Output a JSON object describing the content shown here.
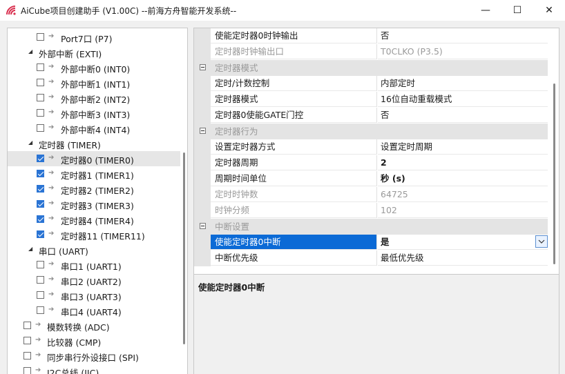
{
  "window": {
    "title": "AiCube项目创建助手 (V1.00C) --前海方舟智能开发系统--",
    "minimize": "—",
    "maximize": "☐",
    "close": "✕"
  },
  "tree": {
    "items": [
      {
        "label": "Port7口 (P7)",
        "checked": false
      },
      {
        "label": "外部中断 (EXTI)"
      },
      {
        "label": "外部中断0 (INT0)",
        "checked": false
      },
      {
        "label": "外部中断1 (INT1)",
        "checked": false
      },
      {
        "label": "外部中断2 (INT2)",
        "checked": false
      },
      {
        "label": "外部中断3 (INT3)",
        "checked": false
      },
      {
        "label": "外部中断4 (INT4)",
        "checked": false
      },
      {
        "label": "定时器 (TIMER)"
      },
      {
        "label": "定时器0 (TIMER0)",
        "checked": true,
        "selected": true
      },
      {
        "label": "定时器1 (TIMER1)",
        "checked": true
      },
      {
        "label": "定时器2 (TIMER2)",
        "checked": true
      },
      {
        "label": "定时器3 (TIMER3)",
        "checked": true
      },
      {
        "label": "定时器4 (TIMER4)",
        "checked": true
      },
      {
        "label": "定时器11 (TIMER11)",
        "checked": true
      },
      {
        "label": "串口 (UART)"
      },
      {
        "label": "串口1 (UART1)",
        "checked": false
      },
      {
        "label": "串口2 (UART2)",
        "checked": false
      },
      {
        "label": "串口3 (UART3)",
        "checked": false
      },
      {
        "label": "串口4 (UART4)",
        "checked": false
      },
      {
        "label": "模数转换 (ADC)",
        "checked": false
      },
      {
        "label": "比较器 (CMP)",
        "checked": false
      },
      {
        "label": "同步串行外设接口 (SPI)",
        "checked": false
      },
      {
        "label": "I2C总线 (IIC)",
        "checked": false
      }
    ]
  },
  "grid": {
    "rows": [
      {
        "name": "使能定时器0时钟输出",
        "value": "否"
      },
      {
        "name": "定时器时钟输出口",
        "value": "T0CLKO (P3.5)",
        "disabled": true
      },
      {
        "category": "定时器模式"
      },
      {
        "name": "定时/计数控制",
        "value": "内部定时"
      },
      {
        "name": "定时器模式",
        "value": "16位自动重载模式"
      },
      {
        "name": "定时器0使能GATE门控",
        "value": "否"
      },
      {
        "category": "定时器行为"
      },
      {
        "name": "设置定时器方式",
        "value": "设置定时周期"
      },
      {
        "name": "定时器周期",
        "value": "2",
        "bold": true
      },
      {
        "name": "周期时间单位",
        "value": "秒 (s)",
        "bold": true
      },
      {
        "name": "定时时钟数",
        "value": "64725",
        "disabled": true
      },
      {
        "name": "时钟分频",
        "value": "102",
        "disabled": true
      },
      {
        "category": "中断设置"
      },
      {
        "name": "使能定时器0中断",
        "value": "是",
        "bold": true,
        "selected": true
      },
      {
        "name": "中断优先级",
        "value": "最低优先级"
      }
    ]
  },
  "description": {
    "title": "使能定时器0中断"
  }
}
